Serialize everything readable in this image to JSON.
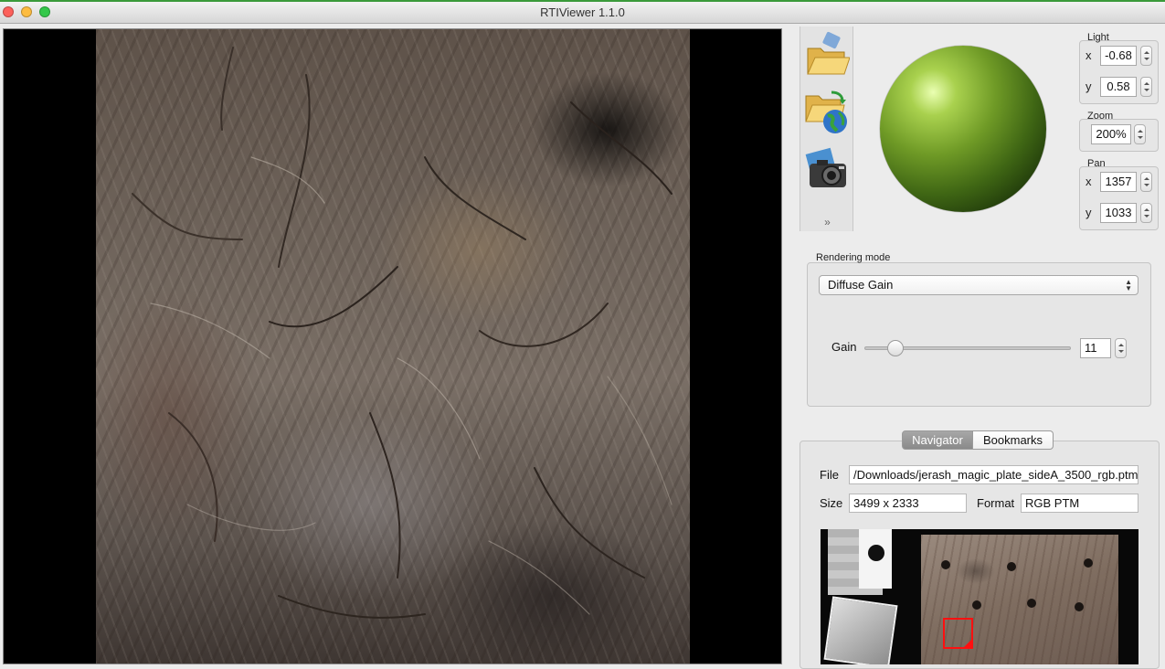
{
  "window": {
    "title": "RTIViewer 1.1.0"
  },
  "toolbar": {
    "open_icon": "open-folder-icon",
    "remote_icon": "open-remote-icon",
    "snapshot_icon": "camera-icon",
    "expand": "»"
  },
  "light": {
    "label": "Light",
    "x_label": "x",
    "x": "-0.68",
    "y_label": "y",
    "y": "0.58"
  },
  "zoom": {
    "label": "Zoom",
    "value": "200%"
  },
  "pan": {
    "label": "Pan",
    "x_label": "x",
    "x": "1357",
    "y_label": "y",
    "y": "1033"
  },
  "rendering": {
    "label": "Rendering mode",
    "mode": "Diffuse Gain",
    "gain_label": "Gain",
    "gain_value": "11",
    "gain_fraction": 0.15
  },
  "navigator": {
    "tabs": [
      "Navigator",
      "Bookmarks"
    ],
    "file_label": "File",
    "file_value": "/Downloads/jerash_magic_plate_sideA_3500_rgb.ptm",
    "size_label": "Size",
    "size_value": "3499 x 2333",
    "format_label": "Format",
    "format_value": "RGB PTM"
  },
  "colors": {
    "sphere": "#6f9a26",
    "selection": "#ff1010",
    "tab_active": "#8a8a8a"
  }
}
